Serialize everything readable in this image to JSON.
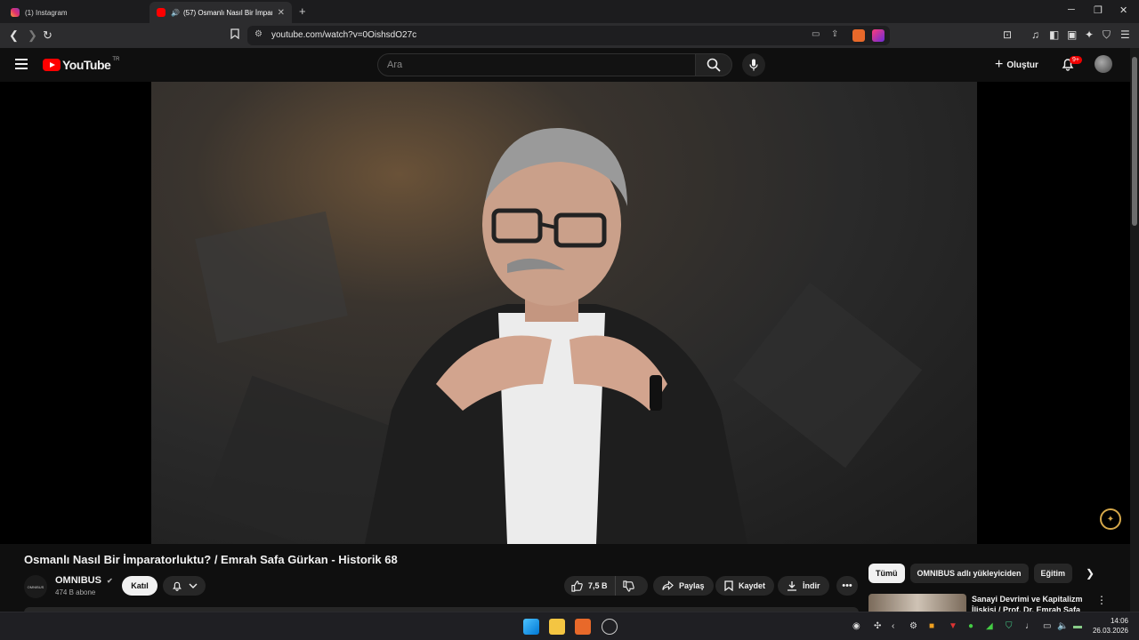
{
  "browser": {
    "tabs": [
      {
        "title": "(1) Instagram",
        "active": false
      },
      {
        "title": "(57) Osmanlı Nasıl Bir İmparat",
        "active": true
      }
    ],
    "url": "youtube.com/watch?v=0OishsdO27c"
  },
  "youtube": {
    "logo_text": "YouTube",
    "country_code": "TR",
    "search_placeholder": "Ara",
    "create_label": "Oluştur",
    "notification_count": "9+"
  },
  "video": {
    "title": "Osmanlı Nasıl Bir İmparatorluktu? / Emrah Safa Gürkan - Historik 68",
    "channel": {
      "avatar_text": "OMNIBUS",
      "name": "OMNIBUS",
      "subscribers": "474 B abone",
      "join_label": "Katıl"
    },
    "actions": {
      "likes": "7,5 B",
      "share": "Paylaş",
      "save": "Kaydet",
      "download": "İndir"
    }
  },
  "sidebar": {
    "chips": [
      "Tümü",
      "OMNIBUS adlı yükleyiciden",
      "Eğitim"
    ],
    "recommendation_title": "Sanayi Devrimi ve Kapitalizm İlişkisi / Prof. Dr. Emrah Safa"
  },
  "taskbar": {
    "time": "14:06",
    "date": "26.03.2026"
  },
  "colors": {
    "youtube_red": "#ff0000",
    "background": "#0f0f0f",
    "chip_bg": "#272727"
  }
}
